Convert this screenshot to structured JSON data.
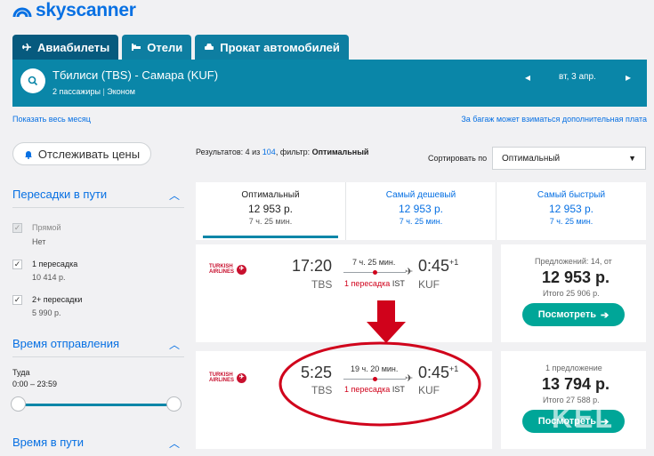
{
  "brand": {
    "name": "skyscanner"
  },
  "tabs": [
    {
      "label": "Авиабилеты",
      "icon": "plane-icon",
      "active": true
    },
    {
      "label": "Отели",
      "icon": "bed-icon",
      "active": false
    },
    {
      "label": "Прокат автомобилей",
      "icon": "car-icon",
      "active": false
    }
  ],
  "search": {
    "route": "Тбилиси (TBS) - Самара (KUF)",
    "passengers": "2 пассажиры",
    "cabin": "Эконом",
    "date": "вт, 3 апр."
  },
  "links": {
    "month": "Показать весь месяц",
    "baggage": "За багаж может взиматься дополнительная плата"
  },
  "left": {
    "track_label": "Отслеживать цены",
    "stops_title": "Пересадки в пути",
    "stops": [
      {
        "label": "Прямой",
        "sub": "Нет",
        "checked": true,
        "disabled": true
      },
      {
        "label": "1 пересадка",
        "sub": "10 414 р.",
        "checked": true,
        "disabled": false
      },
      {
        "label": "2+ пересадки",
        "sub": "5 990 р.",
        "checked": true,
        "disabled": false
      }
    ],
    "departure_title": "Время отправления",
    "outbound_label": "Туда",
    "outbound_range": "0:00 – 23:59",
    "duration_title": "Время в пути"
  },
  "results": {
    "summary_prefix": "Результатов: 4 из ",
    "summary_total": "104",
    "summary_filter_label": ", фильтр: ",
    "summary_filter": "Оптимальный",
    "sort_label": "Сортировать по",
    "sort_value": "Оптимальный"
  },
  "summary_tabs": [
    {
      "title": "Оптимальный",
      "price": "12 953 р.",
      "duration": "7 ч. 25 мин.",
      "active": true
    },
    {
      "title": "Самый дешевый",
      "price": "12 953 р.",
      "duration": "7 ч. 25 мин.",
      "active": false
    },
    {
      "title": "Самый быстрый",
      "price": "12 953 р.",
      "duration": "7 ч. 25 мин.",
      "active": false
    }
  ],
  "flights": [
    {
      "airline": [
        "TURKISH",
        "AIRLINES"
      ],
      "dep_time": "17:20",
      "dep_code": "TBS",
      "arr_time": "0:45",
      "arr_day": "+1",
      "arr_code": "KUF",
      "duration": "7 ч. 25 мин.",
      "stops": "1 пересадка",
      "via": "IST",
      "offers": "Предложений: 14, от",
      "price": "12 953 р.",
      "total": "Итого 25 906 р.",
      "cta": "Посмотреть"
    },
    {
      "airline": [
        "TURKISH",
        "AIRLINES"
      ],
      "dep_time": "5:25",
      "dep_code": "TBS",
      "arr_time": "0:45",
      "arr_day": "+1",
      "arr_code": "KUF",
      "duration": "19 ч. 20 мин.",
      "stops": "1 пересадка",
      "via": "IST",
      "offers": "1 предложение",
      "price": "13 794 р.",
      "total": "Итого 27 588 р.",
      "cta": "Посмотреть"
    }
  ],
  "annotation": {
    "arrow_color": "#d0021b",
    "ellipse_color": "#d0021b"
  },
  "watermark": "KEL",
  "colors": {
    "brand": "#0770e3",
    "header_bar": "#0a86a8",
    "tab_active": "#075a7e",
    "cta": "#00a698",
    "accent_red": "#d0021b"
  }
}
